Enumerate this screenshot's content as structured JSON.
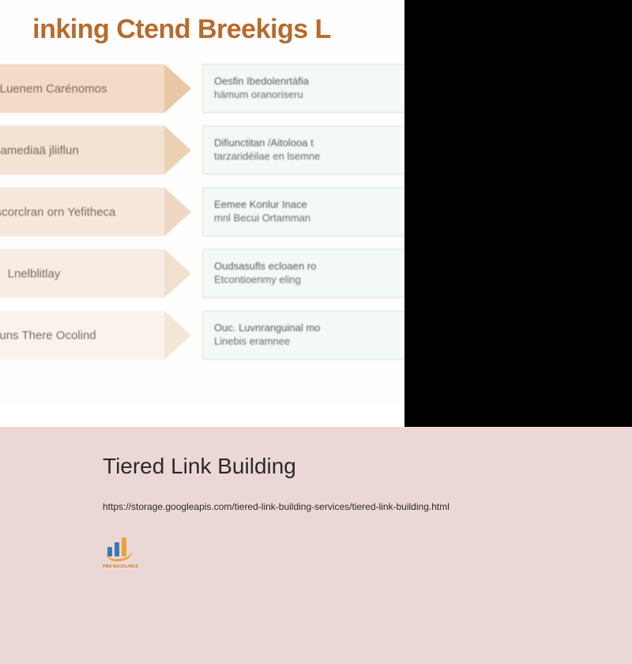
{
  "diagram": {
    "title": "inking Ctend Breekigs L",
    "rows": [
      {
        "label": "odiiar I Luenem Carénomos",
        "desc1": "Oesfin Ibedolenrtáfia",
        "desc2": "hämum oranoriseru"
      },
      {
        "label": "lisamediaä jliiflun",
        "desc1": "Difiunctitan /Aitolooa t",
        "desc2": "tarzaridéilae en lsemne"
      },
      {
        "label": "ansc Cuscorclran orn Yefitheca",
        "desc1": "Eemee Konlur Inace",
        "desc2": "mnl Becui Ortamman"
      },
      {
        "label": "Lnelblitlay",
        "desc1": "Oudsasufls ecloaen ro",
        "desc2": "Etcontioenmy eling"
      },
      {
        "label": "Cosguns There Ocolind",
        "desc1": "Ouc. Luvnranguinal mo",
        "desc2": "Linebis eramnee"
      }
    ]
  },
  "page": {
    "heading": "Tiered Link Building",
    "url": "https://storage.googleapis.com/tiered-link-building-services/tiered-link-building.html",
    "logo_text": "PBN BACKLINKS"
  }
}
